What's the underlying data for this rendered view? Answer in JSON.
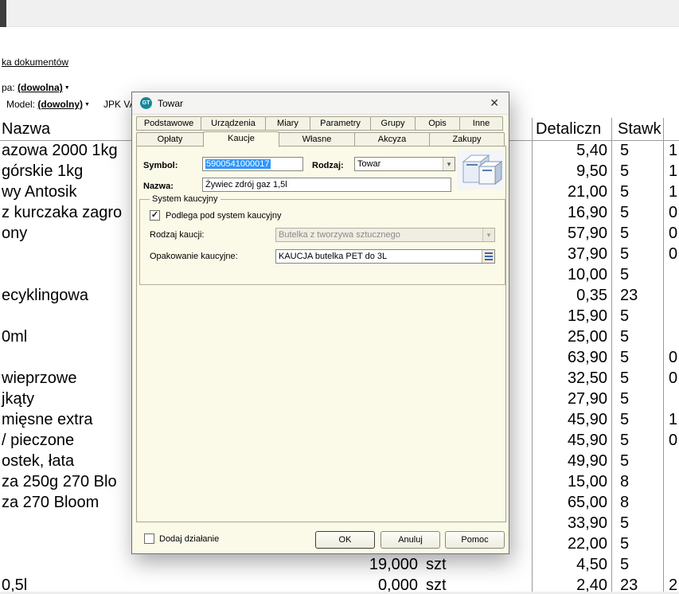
{
  "page": {
    "top_link": "ka dokumentów",
    "filter_group_label": "pa:",
    "filter_group_value": "(dowolna)",
    "filter_model_label": "Model:",
    "filter_model_value": "(dowolny)",
    "jpk_text": "JPK VA",
    "caret_glyph": "▼"
  },
  "table": {
    "header_name": "Nazwa",
    "header_retail": "Detaliczn",
    "header_rate": "Stawk",
    "rows": [
      {
        "name": "azowa 2000 1kg",
        "qty": "",
        "unit": "",
        "retail": "5,40",
        "rate": "5",
        "extra": "1"
      },
      {
        "name": "górskie 1kg",
        "qty": "",
        "unit": "",
        "retail": "9,50",
        "rate": "5",
        "extra": "1"
      },
      {
        "name": "wy Antosik",
        "qty": "",
        "unit": "",
        "retail": "21,00",
        "rate": "5",
        "extra": "1"
      },
      {
        "name": "z kurczaka zagro",
        "qty": "",
        "unit": "",
        "retail": "16,90",
        "rate": "5",
        "extra": "0"
      },
      {
        "name": "ony",
        "qty": "",
        "unit": "",
        "retail": "57,90",
        "rate": "5",
        "extra": "0"
      },
      {
        "name": "",
        "qty": "",
        "unit": "",
        "retail": "37,90",
        "rate": "5",
        "extra": "0"
      },
      {
        "name": "",
        "qty": "",
        "unit": "",
        "retail": "10,00",
        "rate": "5",
        "extra": ""
      },
      {
        "name": "ecyklingowa",
        "qty": "",
        "unit": "",
        "retail": "0,35",
        "rate": "23",
        "extra": ""
      },
      {
        "name": "",
        "qty": "",
        "unit": "",
        "retail": "15,90",
        "rate": "5",
        "extra": ""
      },
      {
        "name": "0ml",
        "qty": "",
        "unit": "",
        "retail": "25,00",
        "rate": "5",
        "extra": ""
      },
      {
        "name": "",
        "qty": "",
        "unit": "",
        "retail": "63,90",
        "rate": "5",
        "extra": "0"
      },
      {
        "name": "wieprzowe",
        "qty": "",
        "unit": "",
        "retail": "32,50",
        "rate": "5",
        "extra": "0"
      },
      {
        "name": "jkąty",
        "qty": "",
        "unit": "",
        "retail": "27,90",
        "rate": "5",
        "extra": ""
      },
      {
        "name": "mięsne extra",
        "qty": "",
        "unit": "",
        "retail": "45,90",
        "rate": "5",
        "extra": "1"
      },
      {
        "name": "/ pieczone",
        "qty": "",
        "unit": "",
        "retail": "45,90",
        "rate": "5",
        "extra": "0"
      },
      {
        "name": "ostek, łata",
        "qty": "",
        "unit": "",
        "retail": "49,90",
        "rate": "5",
        "extra": ""
      },
      {
        "name": "za 250g 270 Blo",
        "qty": "",
        "unit": "",
        "retail": "15,00",
        "rate": "8",
        "extra": ""
      },
      {
        "name": "za 270 Bloom",
        "qty": "",
        "unit": "",
        "retail": "65,00",
        "rate": "8",
        "extra": ""
      },
      {
        "name": "",
        "qty": "",
        "unit": "",
        "retail": "33,90",
        "rate": "5",
        "extra": ""
      },
      {
        "name": "",
        "qty": "",
        "unit": "",
        "retail": "22,00",
        "rate": "5",
        "extra": ""
      },
      {
        "name": "",
        "qty": "19,000",
        "unit": "szt",
        "retail": "4,50",
        "rate": "5",
        "extra": ""
      },
      {
        "name": "0,5l",
        "qty": "0,000",
        "unit": "szt",
        "retail": "2,40",
        "rate": "23",
        "extra": "2"
      }
    ]
  },
  "dialog": {
    "icon_text": "GT",
    "title": "Towar",
    "close_glyph": "✕",
    "tabs_row1": [
      "Podstawowe",
      "Urządzenia",
      "Miary",
      "Parametry",
      "Grupy",
      "Opis",
      "Inne"
    ],
    "tabs_row2": [
      "Opłaty",
      "Kaucje",
      "Własne",
      "Akcyza",
      "Zakupy"
    ],
    "active_tab": "Kaucje",
    "symbol_label": "Symbol:",
    "symbol_value": "5900541000017",
    "rodzaj_label": "Rodzaj:",
    "rodzaj_value": "Towar",
    "nazwa_label": "Nazwa:",
    "nazwa_value": "Żywiec zdrój gaz 1,5l",
    "group_title": "System kaucyjny",
    "deposit_checkbox_label": "Podlega pod system kaucyjny",
    "deposit_type_label": "Rodzaj kaucji:",
    "deposit_type_value": "Butelka z tworzywa sztucznego",
    "packaging_label": "Opakowanie kaucyjne:",
    "packaging_value": "KAUCJA butelka PET do 3L",
    "footer_checkbox_label": "Dodaj działanie",
    "ok_label": "OK",
    "cancel_label": "Anuluj",
    "help_label": "Pomoc",
    "check_glyph": "✓",
    "combo_arrow_glyph": "▾"
  },
  "colors": {
    "dialog_bg": "#fbfae8",
    "selection_bg": "#3095fa",
    "gt_icon_bg": "#17889c",
    "grid_line": "#9b9b9b"
  }
}
